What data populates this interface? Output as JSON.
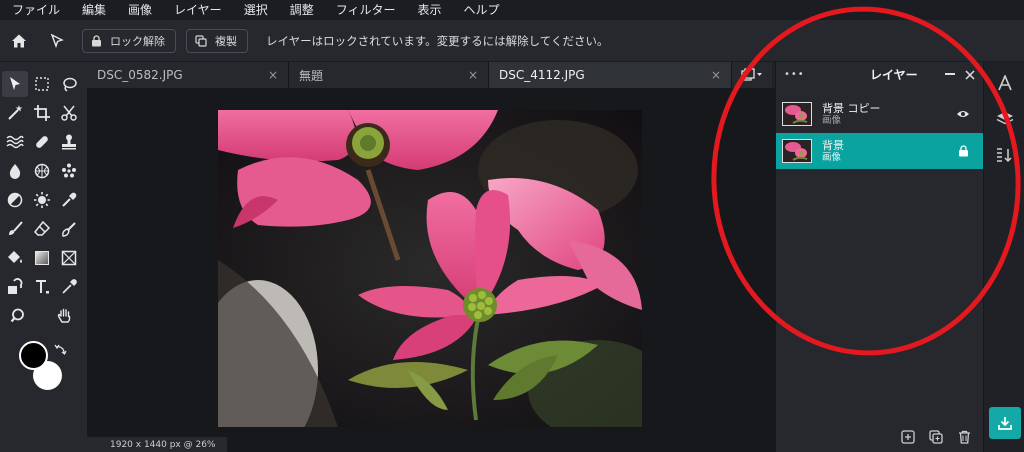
{
  "menu": [
    "ファイル",
    "編集",
    "画像",
    "レイヤー",
    "選択",
    "調整",
    "フィルター",
    "表示",
    "ヘルプ"
  ],
  "options": {
    "unlock_label": "ロック解除",
    "duplicate_label": "複製",
    "message": "レイヤーはロックされています。変更するには解除してください。"
  },
  "tabs": [
    {
      "label": "DSC_0582.JPG",
      "close": "×"
    },
    {
      "label": "無題",
      "close": "×"
    },
    {
      "label": "DSC_4112.JPG",
      "close": "×"
    }
  ],
  "status": {
    "text": "1920 x 1440 px @ 26%"
  },
  "layers": {
    "title": "レイヤー",
    "menu_dots": "•••",
    "items": [
      {
        "name": "背景 コピー",
        "type": "画像",
        "state": "visible"
      },
      {
        "name": "背景",
        "type": "画像",
        "state": "locked"
      }
    ]
  },
  "colors": {
    "accent": "#0aa3a0",
    "export": "#14a9a6",
    "annotation": "#e3191f",
    "foreground": "#000000",
    "background": "#ffffff"
  }
}
